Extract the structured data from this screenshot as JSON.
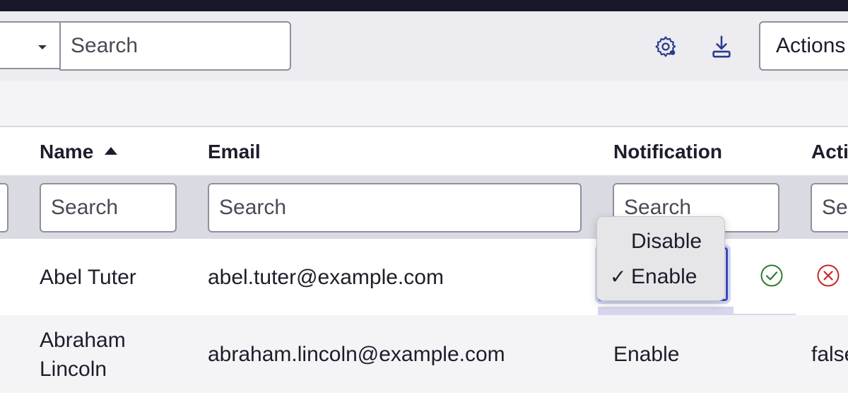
{
  "toolbar": {
    "search_placeholder": "Search",
    "gear_icon": "gear-icon",
    "download_icon": "download-icon",
    "actions_label": "Actions"
  },
  "table": {
    "columns": [
      {
        "label": "Name",
        "sort": "ascending"
      },
      {
        "label": "Email"
      },
      {
        "label": "Notification"
      },
      {
        "label": "Active"
      }
    ],
    "filter_placeholder": "Search",
    "rows": [
      {
        "name": "Abel Tuter",
        "email": "abel.tuter@example.com",
        "notification": "",
        "active": ""
      },
      {
        "name": "Abraham Lincoln",
        "email": "abraham.lincoln@example.com",
        "notification": "Enable",
        "active": "false"
      }
    ]
  },
  "inline_edit": {
    "options": [
      {
        "label": "Disable",
        "selected": false
      },
      {
        "label": "Enable",
        "selected": true
      }
    ],
    "check_mark": "✓",
    "confirm_icon": "check-circle-icon",
    "cancel_icon": "x-circle-icon",
    "colors": {
      "confirm": "#2e7d32",
      "cancel": "#c62828",
      "focus": "#3a4bc8"
    }
  }
}
